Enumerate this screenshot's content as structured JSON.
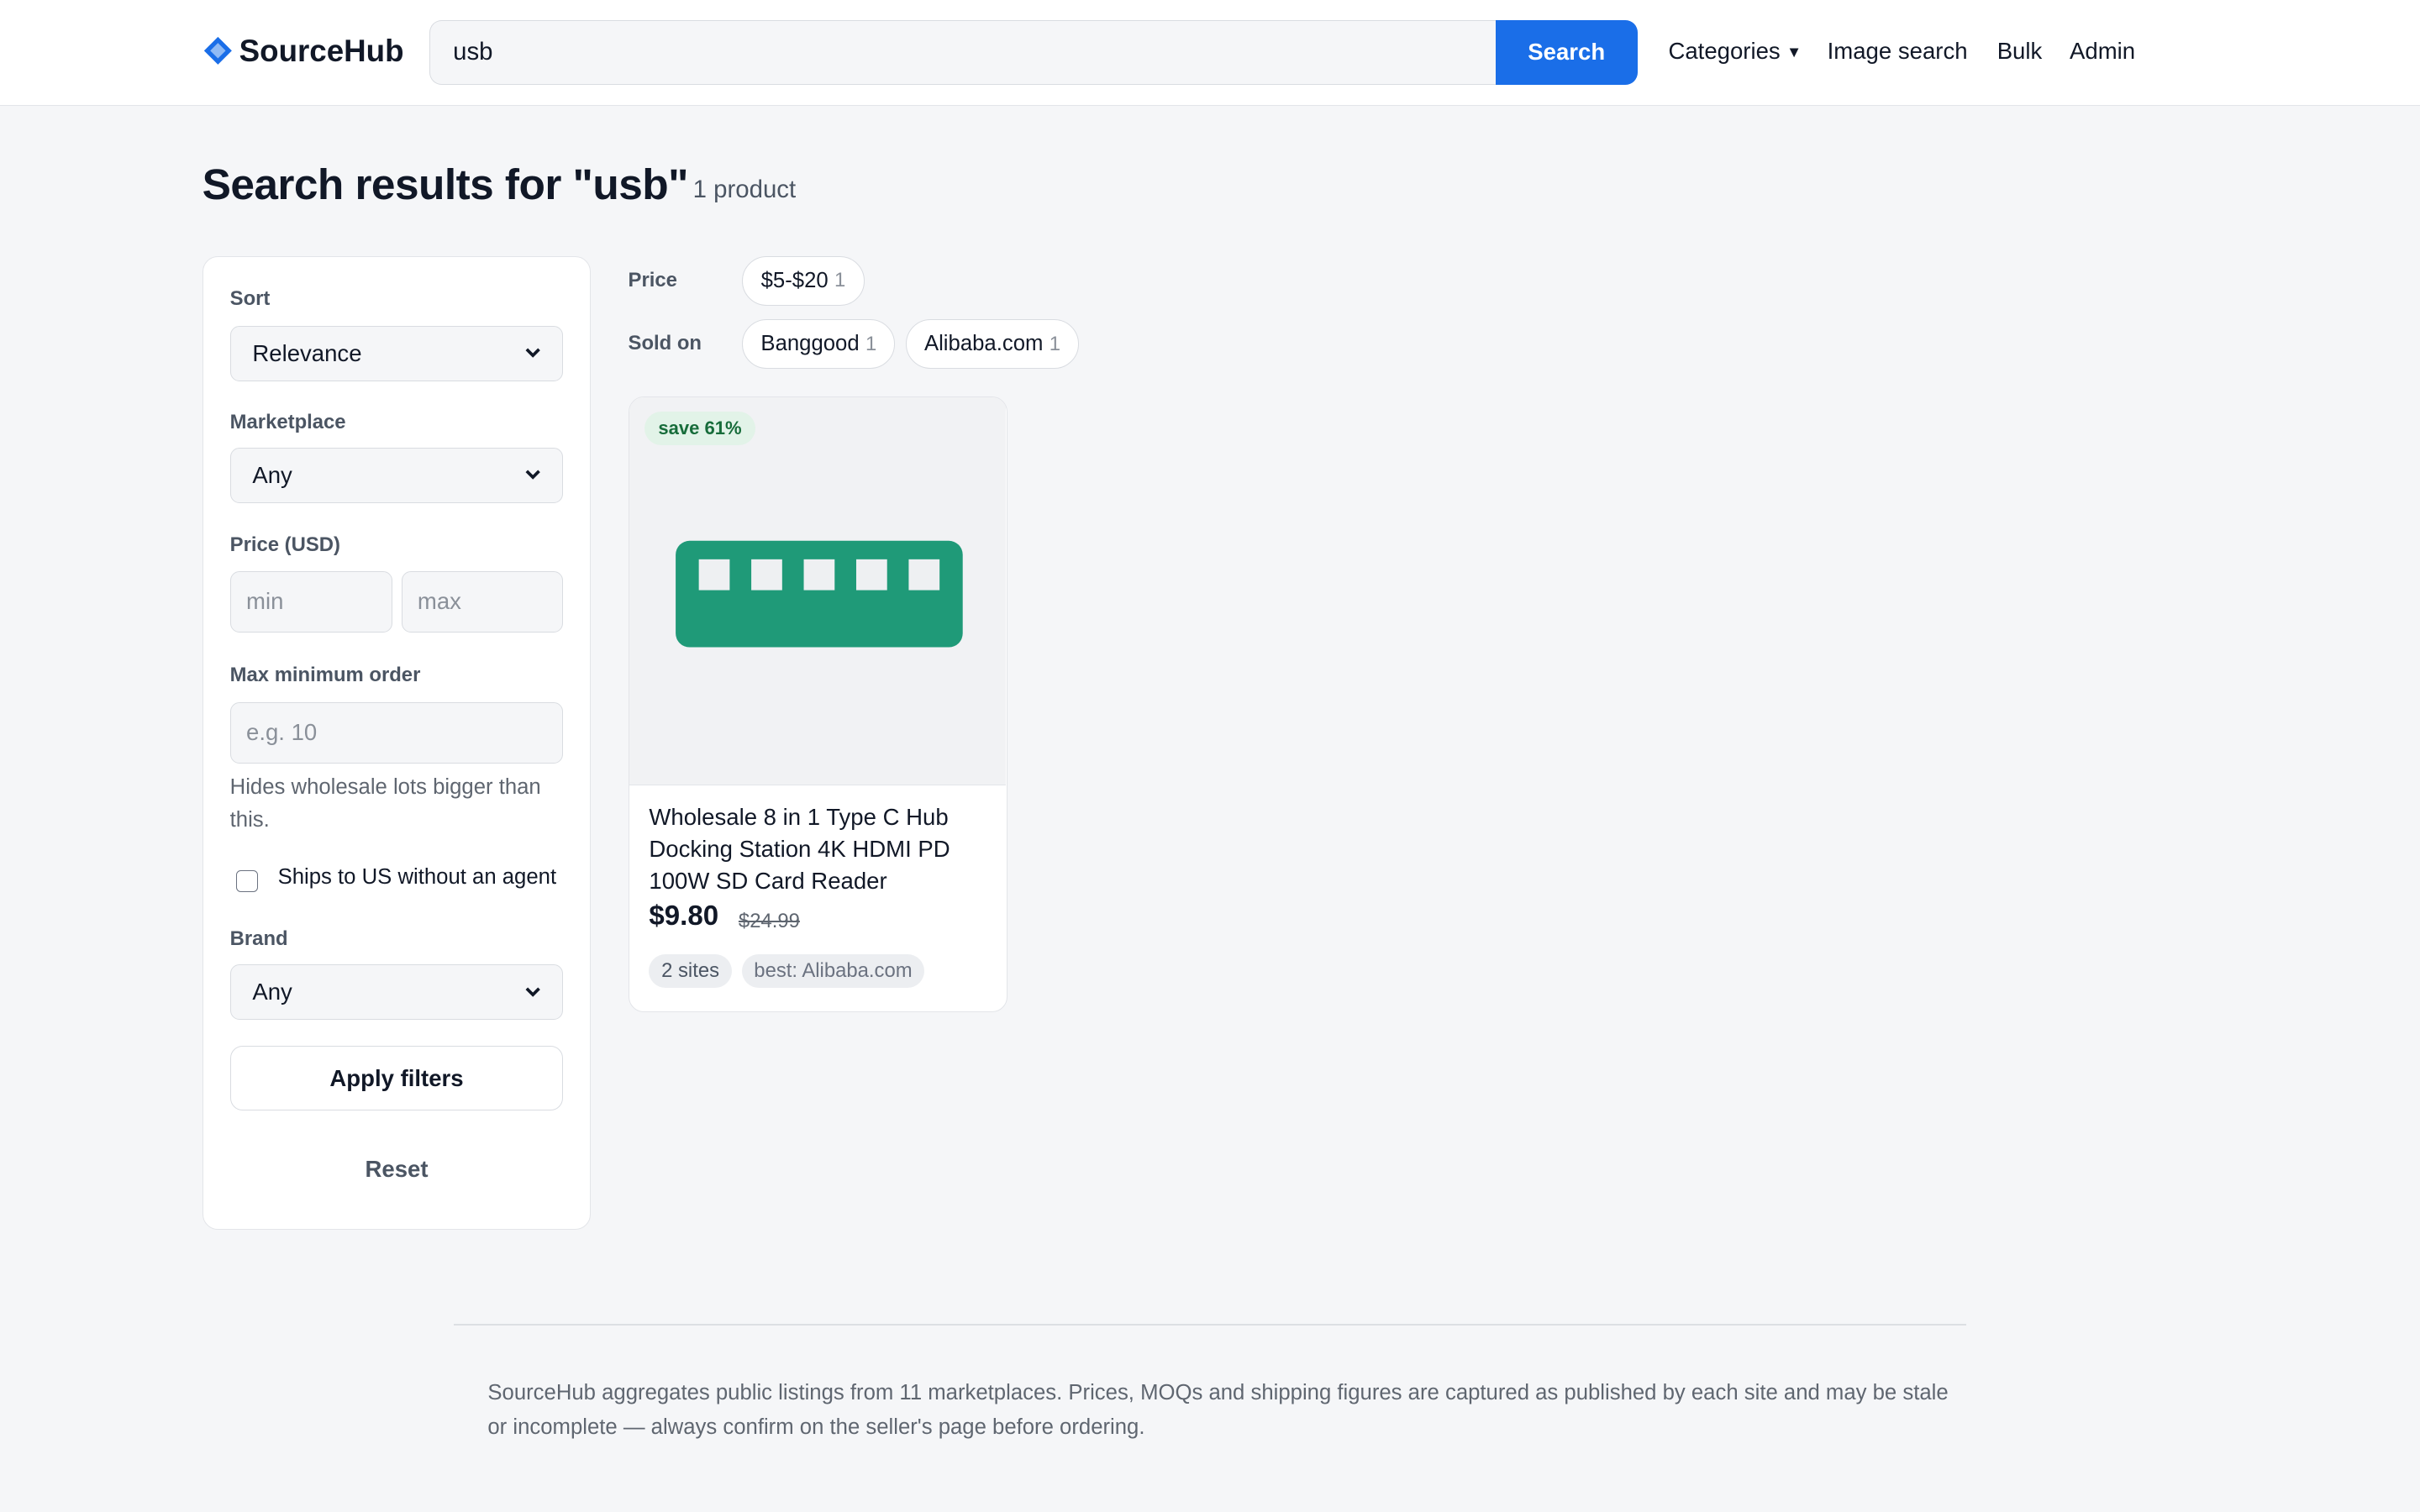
{
  "app": {
    "name": "SourceHub"
  },
  "search": {
    "query": "usb",
    "button_label": "Search"
  },
  "nav": {
    "categories": "Categories",
    "image_search": "Image search",
    "bulk": "Bulk",
    "admin": "Admin"
  },
  "results": {
    "title": "Search results for \"usb\"",
    "count": "1 product"
  },
  "filters": {
    "sort": {
      "label": "Sort",
      "value": "Relevance"
    },
    "marketplace": {
      "label": "Marketplace",
      "value": "Any"
    },
    "price": {
      "label": "Price (USD)",
      "min_placeholder": "min",
      "max_placeholder": "max"
    },
    "moq": {
      "label": "Max minimum order",
      "placeholder": "e.g. 10",
      "help": "Hides wholesale lots bigger than this."
    },
    "ships_us": {
      "label": "Ships to US without an agent",
      "checked": false
    },
    "brand": {
      "label": "Brand",
      "value": "Any"
    },
    "apply_label": "Apply filters",
    "reset_label": "Reset"
  },
  "facets": {
    "price": {
      "label": "Price",
      "chips": [
        {
          "label": "$5-$20",
          "count": "1"
        }
      ]
    },
    "sold_on": {
      "label": "Sold on",
      "chips": [
        {
          "label": "Banggood",
          "count": "1"
        },
        {
          "label": "Alibaba.com",
          "count": "1"
        }
      ]
    }
  },
  "products": [
    {
      "badge": "save 61%",
      "image_icon": "usb-hub-icon",
      "title": "Wholesale 8 in 1 Type C Hub Docking Station 4K HDMI PD 100W SD Card Reader",
      "price": "$9.80",
      "old_price": "$24.99",
      "tags": [
        "2 sites",
        "best: Alibaba.com"
      ]
    }
  ],
  "footer": {
    "text": "SourceHub aggregates public listings from 11 marketplaces. Prices, MOQs and shipping figures are captured as published by each site and may be stale or incomplete — always confirm on the seller's page before ordering."
  },
  "colors": {
    "accent": "#1a6ee8",
    "product_art": "#1f9a78",
    "save_badge_bg": "#e2f3e8",
    "save_badge_text": "#176c3a"
  }
}
